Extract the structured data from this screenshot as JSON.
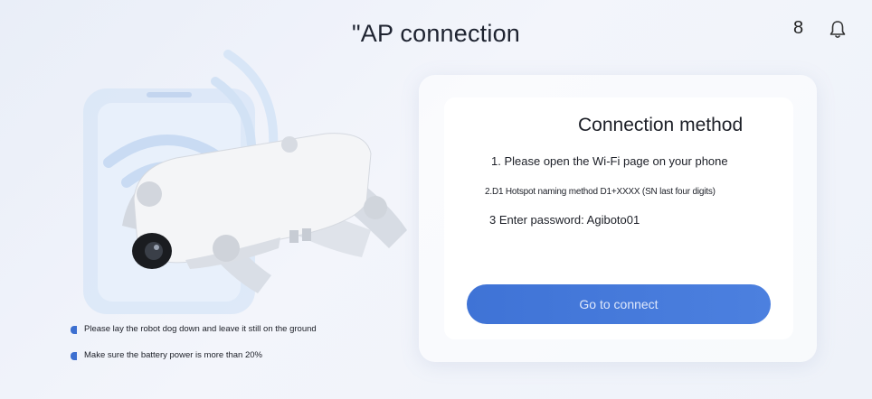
{
  "header": {
    "title": "\"AP connection",
    "badge": "8",
    "bell_icon": "bell-icon"
  },
  "card": {
    "title": "Connection method",
    "steps": [
      "1. Please open the Wi-Fi page on your phone",
      "2.D1 Hotspot naming method D1+XXXX (SN last four digits)",
      "3 Enter password: Agiboto01"
    ],
    "button_label": "Go to connect"
  },
  "tips": [
    "Please lay the robot dog down and leave it still on the ground",
    "Make sure the battery power is more than 20%"
  ],
  "colors": {
    "accent": "#3f73d6",
    "background": "#eef2f9",
    "tip_bullet": "#3c6fd0"
  }
}
